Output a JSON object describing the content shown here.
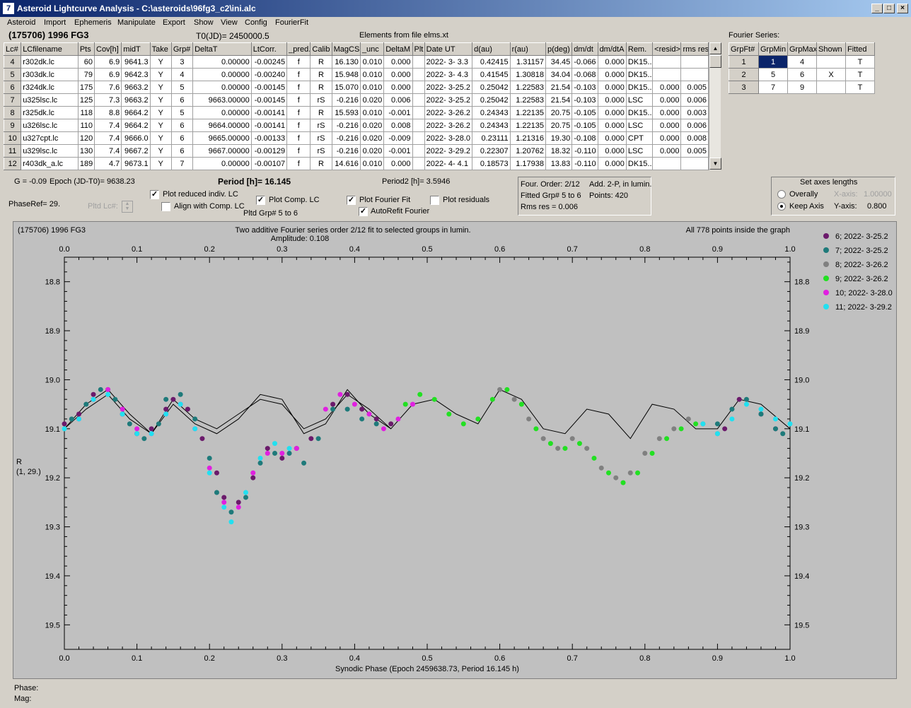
{
  "window": {
    "title": "Asteroid Lightcurve Analysis - C:\\asteroids\\96fg3_c2\\ini.alc",
    "app_icon_glyph": "7"
  },
  "menu": [
    "Asteroid",
    "Import",
    "Ephemeris",
    "Manipulate",
    "Export",
    "Show",
    "View",
    "Config",
    "FourierFit"
  ],
  "header": {
    "asteroid": "(175706) 1996 FG3",
    "t0": "T0(JD)= 2450000.5",
    "elements": "Elements from file elms.xt",
    "fourier_series_label": "Fourier Series:"
  },
  "lc_table": {
    "columns": [
      "Lc#",
      "LCfilename",
      "Pts",
      "Cov[h]",
      "midT",
      "Take",
      "Grp#",
      "DeltaT",
      "LtCorr.",
      "_pred.",
      "Calib",
      "MagCS",
      "_unc",
      "DeltaM",
      "Plt",
      "Date UT",
      "d(au)",
      "r(au)",
      "p(deg)",
      "dm/dt",
      "dm/dtA",
      "Rem.",
      "<resid>",
      "rms res"
    ],
    "rows": [
      [
        "4",
        "r302dk.lc",
        "60",
        "6.9",
        "9641.3",
        "Y",
        "3",
        "0.00000",
        "-0.00245",
        "f",
        "R",
        "16.130",
        "0.010",
        "0.000",
        "",
        "2022- 3- 3.3",
        "0.42415",
        "1.31157",
        "34.45",
        "-0.066",
        "0.000",
        "DK15..",
        "",
        ""
      ],
      [
        "5",
        "r303dk.lc",
        "79",
        "6.9",
        "9642.3",
        "Y",
        "4",
        "0.00000",
        "-0.00240",
        "f",
        "R",
        "15.948",
        "0.010",
        "0.000",
        "",
        "2022- 3- 4.3",
        "0.41545",
        "1.30818",
        "34.04",
        "-0.068",
        "0.000",
        "DK15..",
        "",
        ""
      ],
      [
        "6",
        "r324dk.lc",
        "175",
        "7.6",
        "9663.2",
        "Y",
        "5",
        "0.00000",
        "-0.00145",
        "f",
        "R",
        "15.070",
        "0.010",
        "0.000",
        "",
        "2022- 3-25.2",
        "0.25042",
        "1.22583",
        "21.54",
        "-0.103",
        "0.000",
        "DK15..",
        "0.000",
        "0.005"
      ],
      [
        "7",
        "u325lsc.lc",
        "125",
        "7.3",
        "9663.2",
        "Y",
        "6",
        "9663.00000",
        "-0.00145",
        "f",
        "rS",
        "-0.216",
        "0.020",
        "0.006",
        "",
        "2022- 3-25.2",
        "0.25042",
        "1.22583",
        "21.54",
        "-0.103",
        "0.000",
        "LSC",
        "0.000",
        "0.006"
      ],
      [
        "8",
        "r325dk.lc",
        "118",
        "8.8",
        "9664.2",
        "Y",
        "5",
        "0.00000",
        "-0.00141",
        "f",
        "R",
        "15.593",
        "0.010",
        "-0.001",
        "",
        "2022- 3-26.2",
        "0.24343",
        "1.22135",
        "20.75",
        "-0.105",
        "0.000",
        "DK15..",
        "0.000",
        "0.003"
      ],
      [
        "9",
        "u326lsc.lc",
        "110",
        "7.4",
        "9664.2",
        "Y",
        "6",
        "9664.00000",
        "-0.00141",
        "f",
        "rS",
        "-0.216",
        "0.020",
        "0.008",
        "",
        "2022- 3-26.2",
        "0.24343",
        "1.22135",
        "20.75",
        "-0.105",
        "0.000",
        "LSC",
        "0.000",
        "0.006"
      ],
      [
        "10",
        "u327cpt.lc",
        "120",
        "7.4",
        "9666.0",
        "Y",
        "6",
        "9665.00000",
        "-0.00133",
        "f",
        "rS",
        "-0.216",
        "0.020",
        "-0.009",
        "",
        "2022- 3-28.0",
        "0.23111",
        "1.21316",
        "19.30",
        "-0.108",
        "0.000",
        "CPT",
        "0.000",
        "0.008"
      ],
      [
        "11",
        "u329lsc.lc",
        "130",
        "7.4",
        "9667.2",
        "Y",
        "6",
        "9667.00000",
        "-0.00129",
        "f",
        "rS",
        "-0.216",
        "0.020",
        "-0.001",
        "",
        "2022- 3-29.2",
        "0.22307",
        "1.20762",
        "18.32",
        "-0.110",
        "0.000",
        "LSC",
        "0.000",
        "0.005"
      ],
      [
        "12",
        "r403dk_a.lc",
        "189",
        "4.7",
        "9673.1",
        "Y",
        "7",
        "0.00000",
        "-0.00107",
        "f",
        "R",
        "14.616",
        "0.010",
        "0.000",
        "",
        "2022- 4- 4.1",
        "0.18573",
        "1.17938",
        "13.83",
        "-0.110",
        "0.000",
        "DK15..",
        "",
        ""
      ]
    ]
  },
  "fourier_table": {
    "columns": [
      "GrpFt#",
      "GrpMin",
      "GrpMax",
      "Shown",
      "Fitted"
    ],
    "rows": [
      [
        "1",
        "1",
        "4",
        "",
        "T"
      ],
      [
        "2",
        "5",
        "6",
        "X",
        "T"
      ],
      [
        "3",
        "7",
        "9",
        "",
        "T"
      ]
    ]
  },
  "controls": {
    "g": "G = -0.09",
    "epoch": "Epoch (JD-T0)= 9638.23",
    "period": "Period [h]= 16.145",
    "period2": "Period2 [h]= 3.5946",
    "phaseref": "PhaseRef= 29.",
    "pltd_lc": "Pltd Lc#:",
    "plot_reduced": "Plot reduced indiv. LC",
    "align_comp": "Align with Comp. LC",
    "plot_comp": "Plot Comp. LC",
    "pltd_grp": "Pltd Grp#  5  to   6",
    "plot_fourier": "Plot Fourier Fit",
    "autorefit": "AutoRefit Fourier",
    "plot_residuals": "Plot residuals",
    "info_line1": "Four. Order:  2/12",
    "info_line1b": "Add. 2-P, in lumin.",
    "info_line2": "Fitted Grp# 5 to 6",
    "info_line2b": "Points: 420",
    "info_line3": "Rms res      = 0.006",
    "axes_title": "Set axes lengths",
    "overally": "Overally",
    "keep_axis": "Keep Axis",
    "x_axis_label": "X-axis:",
    "x_axis_val": "1.00000",
    "y_axis_label": "Y-axis:",
    "y_axis_val": "0.800"
  },
  "checks": {
    "plot_reduced": true,
    "align_comp": false,
    "plot_comp": true,
    "plot_fourier": true,
    "autorefit": true,
    "plot_residuals": false,
    "keep_axis": true
  },
  "plot": {
    "top_left": "(175706) 1996 FG3",
    "title_line1": "Two additive Fourier series order 2/12 fit to selected groups in lumin.",
    "title_line2": "Amplitude: 0.108",
    "top_right": "All 778 points inside the graph",
    "xlabel": "Synodic Phase (Epoch 2459638.73, Period 16.145 h)",
    "ylabel_line1": "R",
    "ylabel_line2": "(1, 29.)",
    "footer_phase": "Phase:",
    "footer_mag": "Mag:"
  },
  "chart_data": {
    "type": "scatter",
    "xlim": [
      0.0,
      1.0
    ],
    "ylim": [
      19.55,
      18.75
    ],
    "y_inverted": true,
    "x_ticks": [
      0.0,
      0.1,
      0.2,
      0.3,
      0.4,
      0.5,
      0.6,
      0.7,
      0.8,
      0.9,
      1.0
    ],
    "x_tick_labels": [
      "0.0",
      "0.1",
      "0.2",
      "0.3",
      "0.4",
      "0.5",
      "0.6",
      "0.7",
      "0.8",
      "0.9",
      "1.0"
    ],
    "y_ticks": [
      18.8,
      18.9,
      19.0,
      19.1,
      19.2,
      19.3,
      19.4,
      19.5
    ],
    "y_tick_labels": [
      "18.8",
      "18.9",
      "19.0",
      "19.1",
      "19.2",
      "19.3",
      "19.4",
      "19.5"
    ],
    "legend_position": "top-right",
    "series": [
      {
        "name": "6; 2022- 3-25.2",
        "color": "#6b1a6b",
        "x": [
          0.0,
          0.02,
          0.04,
          0.06,
          0.08,
          0.1,
          0.12,
          0.14,
          0.15,
          0.17,
          0.19,
          0.21,
          0.22,
          0.24,
          0.26,
          0.28,
          0.3,
          0.32,
          0.34,
          0.37,
          0.39,
          0.41,
          0.43,
          0.45,
          0.98,
          0.96,
          0.93,
          0.91
        ],
        "y": [
          19.09,
          19.07,
          19.03,
          19.02,
          19.07,
          19.11,
          19.1,
          19.06,
          19.04,
          19.06,
          19.12,
          19.19,
          19.24,
          19.25,
          19.2,
          19.14,
          19.16,
          19.14,
          19.12,
          19.05,
          19.03,
          19.06,
          19.08,
          19.09,
          19.1,
          19.07,
          19.04,
          19.1
        ]
      },
      {
        "name": "7; 2022- 3-25.2",
        "color": "#1e7a7a",
        "x": [
          0.01,
          0.03,
          0.05,
          0.07,
          0.09,
          0.11,
          0.13,
          0.14,
          0.16,
          0.18,
          0.2,
          0.21,
          0.23,
          0.25,
          0.27,
          0.29,
          0.31,
          0.33,
          0.35,
          0.37,
          0.39,
          0.41,
          0.43,
          0.9,
          0.92,
          0.94,
          0.96,
          0.98,
          0.99
        ],
        "y": [
          19.08,
          19.05,
          19.02,
          19.04,
          19.09,
          19.12,
          19.09,
          19.04,
          19.03,
          19.08,
          19.16,
          19.23,
          19.27,
          19.24,
          19.17,
          19.15,
          19.15,
          19.17,
          19.12,
          19.06,
          19.06,
          19.08,
          19.09,
          19.09,
          19.06,
          19.04,
          19.07,
          19.1,
          19.11
        ]
      },
      {
        "name": "8; 2022- 3-26.2",
        "color": "#808080",
        "x": [
          0.6,
          0.62,
          0.64,
          0.66,
          0.68,
          0.7,
          0.72,
          0.74,
          0.76,
          0.78,
          0.8,
          0.82,
          0.84,
          0.86,
          0.88,
          0.9
        ],
        "y": [
          19.02,
          19.04,
          19.08,
          19.12,
          19.14,
          19.12,
          19.14,
          19.18,
          19.2,
          19.19,
          19.15,
          19.12,
          19.1,
          19.08,
          19.09,
          19.11
        ]
      },
      {
        "name": "9; 2022- 3-26.2",
        "color": "#22e022",
        "x": [
          0.47,
          0.49,
          0.51,
          0.53,
          0.55,
          0.57,
          0.59,
          0.61,
          0.63,
          0.65,
          0.67,
          0.69,
          0.71,
          0.73,
          0.75,
          0.77,
          0.79,
          0.81,
          0.83,
          0.85,
          0.87
        ],
        "y": [
          19.05,
          19.03,
          19.04,
          19.07,
          19.09,
          19.08,
          19.04,
          19.02,
          19.05,
          19.1,
          19.13,
          19.14,
          19.13,
          19.16,
          19.19,
          19.21,
          19.19,
          19.15,
          19.12,
          19.1,
          19.09
        ]
      },
      {
        "name": "10; 2022- 3-28.0",
        "color": "#e020e0",
        "x": [
          0.02,
          0.04,
          0.06,
          0.08,
          0.1,
          0.12,
          0.14,
          0.16,
          0.18,
          0.2,
          0.22,
          0.24,
          0.26,
          0.28,
          0.3,
          0.32,
          0.36,
          0.38,
          0.4,
          0.42,
          0.44,
          0.46,
          0.48
        ],
        "y": [
          19.08,
          19.04,
          19.02,
          19.06,
          19.1,
          19.11,
          19.07,
          19.05,
          19.1,
          19.18,
          19.25,
          19.26,
          19.19,
          19.15,
          19.15,
          19.14,
          19.06,
          19.03,
          19.05,
          19.07,
          19.1,
          19.08,
          19.05
        ]
      },
      {
        "name": "11; 2022- 3-29.2",
        "color": "#22e0f0",
        "x": [
          0.0,
          0.02,
          0.04,
          0.06,
          0.08,
          0.1,
          0.12,
          0.14,
          0.16,
          0.18,
          0.2,
          0.22,
          0.23,
          0.25,
          0.27,
          0.29,
          0.31,
          0.88,
          0.9,
          0.92,
          0.94,
          0.96,
          0.98,
          1.0
        ],
        "y": [
          19.1,
          19.08,
          19.04,
          19.03,
          19.07,
          19.11,
          19.11,
          19.07,
          19.05,
          19.1,
          19.19,
          19.26,
          19.29,
          19.23,
          19.16,
          19.13,
          19.14,
          19.09,
          19.11,
          19.08,
          19.05,
          19.06,
          19.08,
          19.09
        ]
      }
    ],
    "fourier_curves": [
      {
        "x": [
          0.0,
          0.03,
          0.06,
          0.09,
          0.12,
          0.15,
          0.18,
          0.21,
          0.24,
          0.27,
          0.3,
          0.33,
          0.36,
          0.39,
          0.42,
          0.45,
          0.48,
          0.51,
          0.54,
          0.57,
          0.6,
          0.63,
          0.66,
          0.69,
          0.72,
          0.75,
          0.78,
          0.81,
          0.84,
          0.87,
          0.9,
          0.93,
          0.96,
          1.0
        ],
        "y": [
          19.1,
          19.05,
          19.02,
          19.07,
          19.11,
          19.04,
          19.08,
          19.1,
          19.07,
          19.04,
          19.05,
          19.1,
          19.08,
          19.03,
          19.06,
          19.1,
          19.05,
          19.04,
          19.07,
          19.09,
          19.02,
          19.04,
          19.1,
          19.11,
          19.06,
          19.07,
          19.12,
          19.05,
          19.06,
          19.1,
          19.1,
          19.04,
          19.05,
          19.1
        ]
      },
      {
        "x": [
          0.0,
          0.03,
          0.06,
          0.09,
          0.12,
          0.15,
          0.18,
          0.21,
          0.24,
          0.27,
          0.3,
          0.33,
          0.36,
          0.39,
          0.42,
          0.45
        ],
        "y": [
          19.1,
          19.06,
          19.03,
          19.08,
          19.11,
          19.05,
          19.09,
          19.11,
          19.08,
          19.03,
          19.04,
          19.11,
          19.09,
          19.02,
          19.07,
          19.1
        ]
      }
    ]
  }
}
